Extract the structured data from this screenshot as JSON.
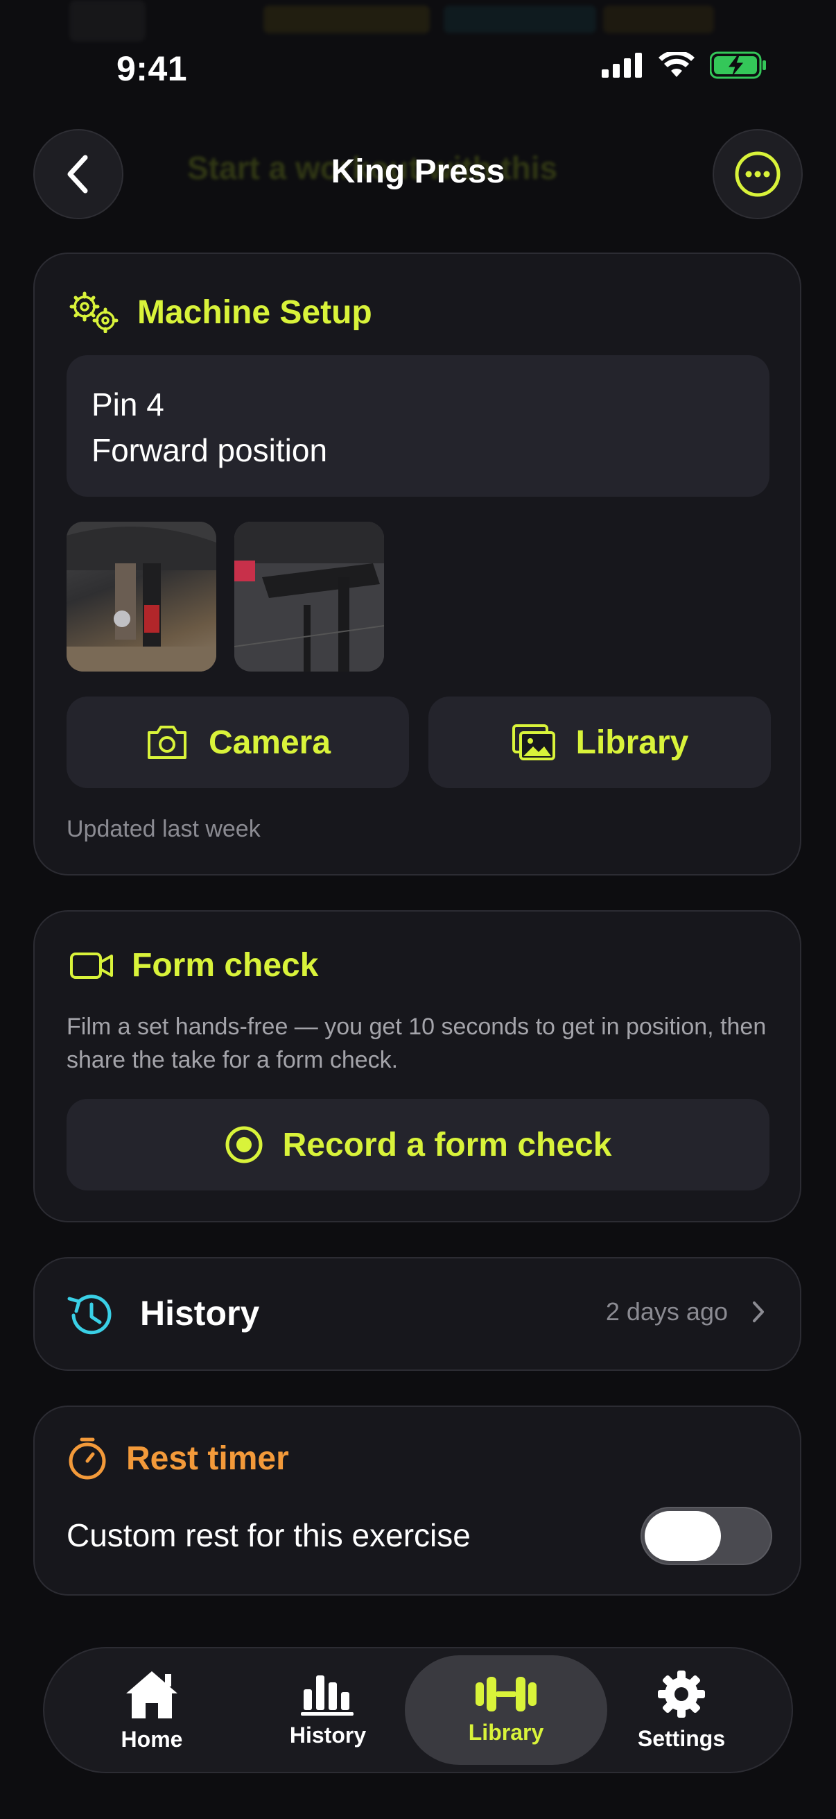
{
  "status_bar": {
    "time": "9:41"
  },
  "nav": {
    "title": "King Press",
    "ghost_text": "Start a workout with this"
  },
  "machine_setup": {
    "title": "Machine Setup",
    "note_line1": "Pin 4",
    "note_line2": "Forward position",
    "camera_label": "Camera",
    "library_label": "Library",
    "updated": "Updated last week"
  },
  "form_check": {
    "title": "Form check",
    "description": "Film a set hands-free — you get 10 seconds to get in position, then share the take for a form check.",
    "record_label": "Record a form check"
  },
  "history": {
    "title": "History",
    "last": "2 days ago"
  },
  "rest_timer": {
    "title": "Rest timer",
    "custom_label": "Custom rest for this exercise",
    "custom_enabled": false
  },
  "tabs": [
    {
      "label": "Home",
      "icon": "house-icon"
    },
    {
      "label": "History",
      "icon": "bar-chart-icon"
    },
    {
      "label": "Library",
      "icon": "dumbbell-icon",
      "active": true
    },
    {
      "label": "Settings",
      "icon": "gear-icon"
    }
  ],
  "colors": {
    "accent": "#d9f33a",
    "history_icon": "#3ad0e6",
    "rest_timer": "#f39a3a",
    "background": "#0d0d10",
    "card": "#17171c"
  }
}
